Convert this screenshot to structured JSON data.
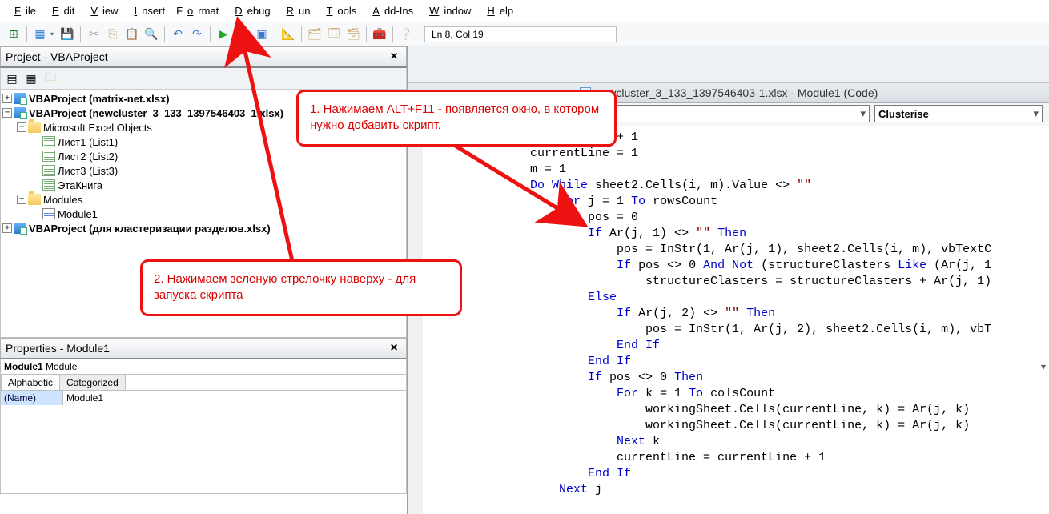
{
  "menu": {
    "file": "File",
    "edit": "Edit",
    "view": "View",
    "insert": "Insert",
    "format": "Format",
    "debug": "Debug",
    "run": "Run",
    "tools": "Tools",
    "addins": "Add-Ins",
    "window": "Window",
    "help": "Help"
  },
  "toolbar": {
    "cursor": "Ln 8, Col 19"
  },
  "project_panel": {
    "title": "Project - VBAProject",
    "nodes": {
      "p1": "VBAProject (matrix-net.xlsx)",
      "p2": "VBAProject (newcluster_3_133_1397546403_1.xlsx)",
      "meo": "Microsoft Excel Objects",
      "s1": "Лист1 (List1)",
      "s2": "Лист2 (List2)",
      "s3": "Лист3 (List3)",
      "wb": "ЭтаКнига",
      "mods": "Modules",
      "m1": "Module1",
      "p3": "VBAProject (для кластеризации разделов.xlsx)"
    }
  },
  "props_panel": {
    "title": "Properties - Module1",
    "object_bold": "Module1",
    "object_type": " Module",
    "tabs": {
      "alpha": "Alphabetic",
      "cat": "Categorized"
    },
    "row": {
      "key": "(Name)",
      "val": "Module1"
    }
  },
  "code_window": {
    "title": "newcluster_3_133_1397546403-1.xlsx - Module1 (Code)",
    "dd_proc": "Clusterise"
  },
  "code": {
    "l1a": "etNum = workingSheetNum + 1",
    "l2": "            currentLine = 1",
    "l3": "            m = 1",
    "l4_a": "            ",
    "l4_kw1": "Do While",
    "l4_b": " sheet2.Cells(i, m).Value <> ",
    "l4_s": "\"\"",
    "l5_a": "                ",
    "l5_kw1": "For",
    "l5_b": " j = 1 ",
    "l5_kw2": "To",
    "l5_c": " rowsCount",
    "l6": "                    pos = 0",
    "l7_a": "                    ",
    "l7_kw1": "If",
    "l7_b": " Ar(j, 1) <> ",
    "l7_s": "\"\"",
    "l7_c": " ",
    "l7_kw2": "Then",
    "l8": "                        pos = InStr(1, Ar(j, 1), sheet2.Cells(i, m), vbTextC",
    "l9_a": "                        ",
    "l9_kw1": "If",
    "l9_b": " pos <> 0 ",
    "l9_kw2": "And Not",
    "l9_c": " (structureClasters ",
    "l9_kw3": "Like",
    "l9_d": " (Ar(j, 1",
    "l10": "                            structureClasters = structureClasters + Ar(j, 1)",
    "l11_a": "                    ",
    "l11_kw": "Else",
    "l12_a": "                        ",
    "l12_kw1": "If",
    "l12_b": " Ar(j, 2) <> ",
    "l12_s": "\"\"",
    "l12_c": " ",
    "l12_kw2": "Then",
    "l13": "                            pos = InStr(1, Ar(j, 2), sheet2.Cells(i, m), vbT",
    "l14_a": "                        ",
    "l14_kw": "End If",
    "l15_a": "                    ",
    "l15_kw": "End If",
    "l16_a": "                    ",
    "l16_kw1": "If",
    "l16_b": " pos <> 0 ",
    "l16_kw2": "Then",
    "l17_a": "                        ",
    "l17_kw1": "For",
    "l17_b": " k = 1 ",
    "l17_kw2": "To",
    "l17_c": " colsCount",
    "l18": "                            workingSheet.Cells(currentLine, k) = Ar(j, k)",
    "l19": "                            workingSheet.Cells(currentLine, k) = Ar(j, k)",
    "l20_a": "                        ",
    "l20_kw": "Next",
    "l20_b": " k",
    "l21": "                        currentLine = currentLine + 1",
    "l22_a": "                    ",
    "l22_kw": "End If",
    "l23_a": "                ",
    "l23_kw": "Next",
    "l23_b": " j"
  },
  "annotations": {
    "a1": "1. Нажимаем ALT+F11  - появляется окно, в котором нужно добавить скрипт.",
    "a2": "2.  Нажимаем зеленую стрелочку наверху - для запуска скрипта"
  }
}
